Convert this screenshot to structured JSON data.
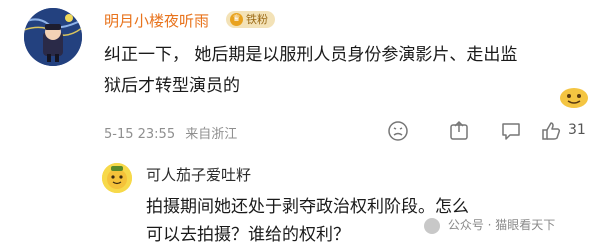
{
  "comment": {
    "username": "明月小楼夜听雨",
    "badge_label": "铁粉",
    "text": "纠正一下， 她后期是以服刑人员身份参演影片、走出监狱后才转型演员的",
    "timestamp": "5-15 23:55",
    "location": "来自浙江",
    "like_count": "31",
    "icons": [
      "dislike-icon",
      "share-icon",
      "comment-icon",
      "like-icon"
    ]
  },
  "reply": {
    "username": "可人茄子爱吐籽",
    "text": "拍摄期间她还处于剥夺政治权利阶段。怎么可以去拍摄？谁给的权利？"
  },
  "watermark": {
    "text": "公众号 · 猫眼看天下"
  },
  "colors": {
    "username_orange": "#e8731c",
    "meta_gray": "#8f8f8f",
    "badge_bg": "#f3e2b7"
  }
}
